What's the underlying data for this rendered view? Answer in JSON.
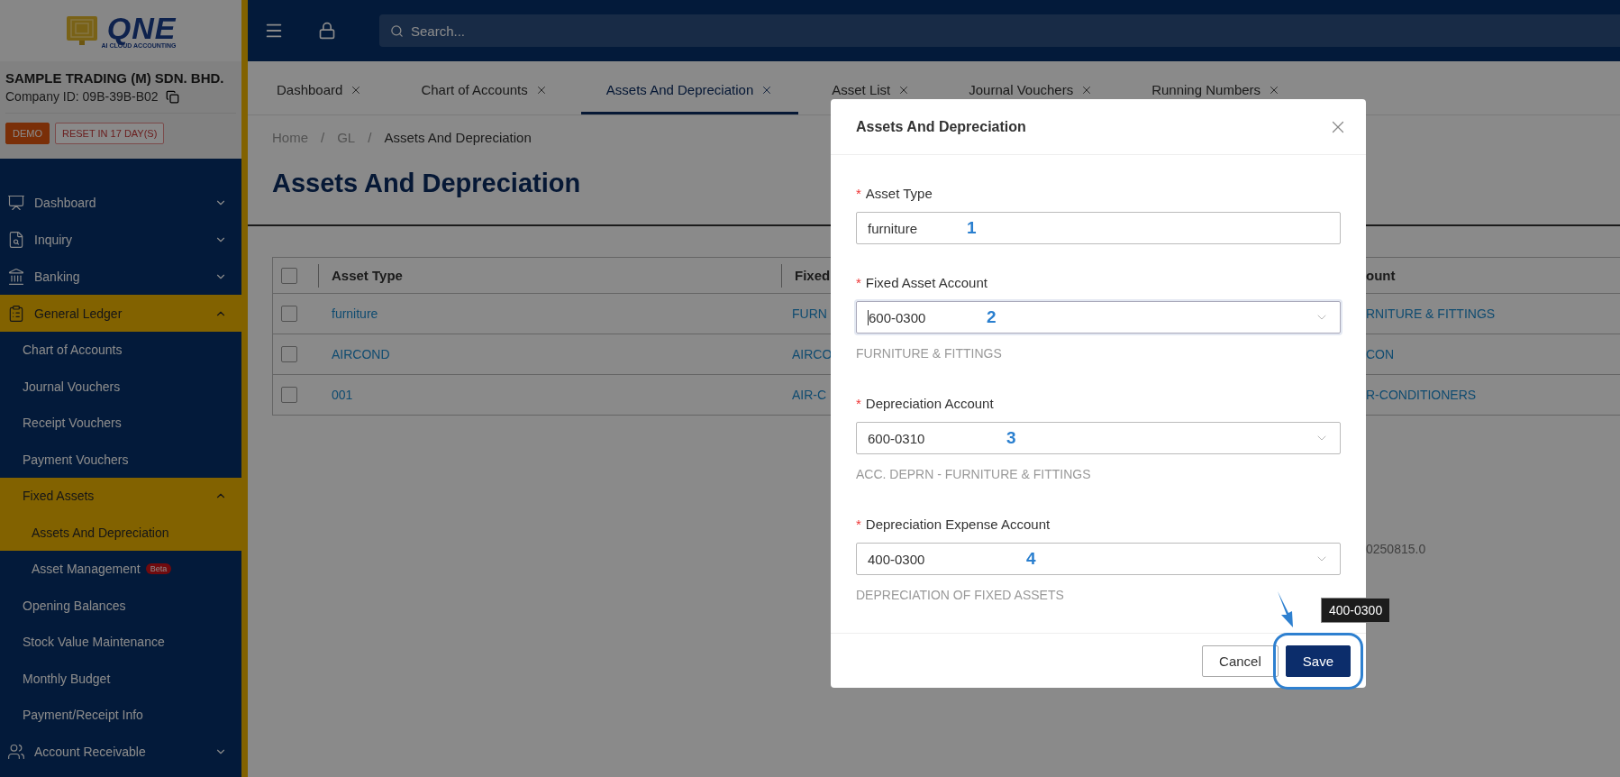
{
  "logo": {
    "name": "QNE",
    "tagline": "AI CLOUD ACCOUNTING"
  },
  "topbar": {
    "search": {
      "placeholder": "Search..."
    }
  },
  "company": {
    "name": "SAMPLE TRADING (M) SDN. BHD.",
    "id_label": "Company ID: 09B-39B-B02",
    "badges": [
      {
        "label": "DEMO",
        "kind": "solid"
      },
      {
        "label": "RESET IN 17 DAY(S)",
        "kind": "outline"
      }
    ]
  },
  "sidebar": {
    "items": [
      {
        "label": "Dashboard",
        "expanded": false,
        "selected": false
      },
      {
        "label": "Inquiry",
        "expanded": false,
        "selected": false
      },
      {
        "label": "Banking",
        "expanded": false,
        "selected": false
      },
      {
        "label": "General Ledger",
        "expanded": true,
        "selected": true,
        "children": [
          {
            "label": "Chart of Accounts",
            "selected": false
          },
          {
            "label": "Journal Vouchers",
            "selected": false
          },
          {
            "label": "Receipt Vouchers",
            "selected": false
          },
          {
            "label": "Payment Vouchers",
            "selected": false
          },
          {
            "label": "Fixed Assets",
            "expanded": true,
            "selected": true,
            "children": [
              {
                "label": "Assets And Depreciation",
                "selected": true
              },
              {
                "label": "Asset Management",
                "selected": false,
                "badge": "Beta"
              }
            ]
          },
          {
            "label": "Opening Balances",
            "selected": false
          },
          {
            "label": "Stock Value Maintenance",
            "selected": false
          },
          {
            "label": "Monthly Budget",
            "selected": false
          },
          {
            "label": "Payment/Receipt Info",
            "selected": false
          }
        ]
      },
      {
        "label": "Account Receivable",
        "expanded": false,
        "selected": false
      }
    ]
  },
  "tabs": [
    {
      "label": "Dashboard",
      "selected": false
    },
    {
      "label": "Chart of Accounts",
      "selected": false
    },
    {
      "label": "Assets And Depreciation",
      "selected": true
    },
    {
      "label": "Asset List",
      "selected": false
    },
    {
      "label": "Journal Vouchers",
      "selected": false
    },
    {
      "label": "Running Numbers",
      "selected": false
    }
  ],
  "breadcrumb": {
    "separator": "/",
    "items": [
      "Home",
      "GL",
      "Assets And Depreciation"
    ]
  },
  "page_title": "Assets And Depreciation",
  "table": {
    "header_checked": false,
    "columns": [
      "Asset Type",
      "Fixed",
      "ount"
    ],
    "rows": [
      {
        "checked": false,
        "cells": [
          "furniture",
          "FURN",
          "RNITURE & FITTINGS"
        ]
      },
      {
        "checked": false,
        "cells": [
          "AIRCOND",
          "AIRCO",
          "CON"
        ]
      },
      {
        "checked": false,
        "cells": [
          "001",
          "AIR-C",
          "R-CONDITIONERS"
        ]
      }
    ]
  },
  "version": "0250815.0",
  "dialog": {
    "title": "Assets And Depreciation",
    "required_mark": "*",
    "fields": [
      {
        "kind": "text",
        "label": "Asset Type",
        "required": true,
        "value": "furniture",
        "marker": "1",
        "focused": false
      },
      {
        "kind": "select",
        "label": "Fixed Asset Account",
        "required": true,
        "value": "600-0300",
        "marker": "2",
        "helper": "FURNITURE & FITTINGS",
        "focused": true
      },
      {
        "kind": "select",
        "label": "Depreciation Account",
        "required": true,
        "value": "600-0310",
        "marker": "3",
        "helper": "ACC. DEPRN - FURNITURE & FITTINGS",
        "focused": false
      },
      {
        "kind": "select",
        "label": "Depreciation Expense Account",
        "required": true,
        "value": "400-0300",
        "marker": "4",
        "helper": "DEPRECIATION OF FIXED ASSETS",
        "focused": false
      }
    ],
    "buttons": [
      {
        "label": "Cancel",
        "kind": "secondary",
        "highlighted": false
      },
      {
        "label": "Save",
        "kind": "primary",
        "highlighted": true
      }
    ],
    "tooltip": "400-0300"
  }
}
